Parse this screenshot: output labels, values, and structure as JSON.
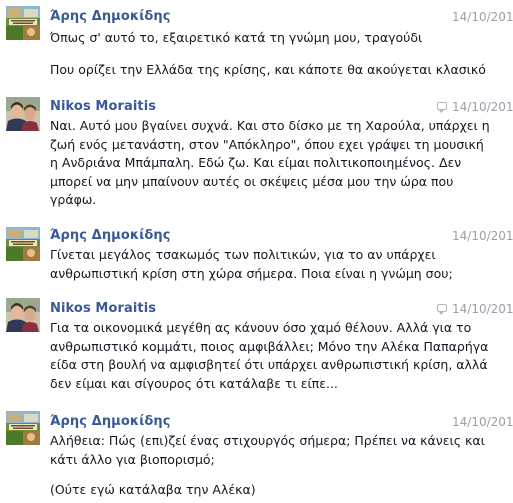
{
  "messages": [
    {
      "author": "Άρης Δημοκίδης",
      "time": "14/10/201",
      "seen_icon": false,
      "avatar": "collage-avatar",
      "paragraphs": [
        "Όπως σ' αυτό το, εξαιρετικό κατά τη γνώμη μου, τραγούδι",
        "Που ορίζει την Ελλάδα της κρίσης, και κάποτε θα ακούγεται κλασικό"
      ]
    },
    {
      "author": "Nikos Moraitis",
      "time": "14/10/201",
      "seen_icon": true,
      "avatar": "portrait-avatar",
      "paragraphs": [
        "Ναι. Αυτό μου βγαίνει συχνά. Και στο δίσκο με τη Χαρούλα, υπάρχει η ζωή ενός μετανάστη, στον \"Απόκληρο\", όπου εχει γράψει τη μουσική η Ανδριάνα Μπάμπαλη. Εδώ ζω. Και είμαι πολιτικοποιημένος. Δεν μπορεί να μην μπαίνουν αυτές οι σκέψεις μέσα μου την ώρα που γράφω."
      ]
    },
    {
      "author": "Άρης Δημοκίδης",
      "time": "14/10/201",
      "seen_icon": false,
      "avatar": "collage-avatar",
      "paragraphs": [
        "Γίνεται μεγάλος τσακωμός των πολιτικών, για το αν υπάρχει ανθρωπιστική κρίση στη χώρα σήμερα. Ποια είναι η γνώμη σου;"
      ]
    },
    {
      "author": "Nikos Moraitis",
      "time": "14/10/201",
      "seen_icon": true,
      "avatar": "portrait-avatar",
      "paragraphs": [
        "Για τα οικονομικά μεγέθη ας κάνουν όσο χαμό θέλουν. Αλλά για το ανθρωπιστικό κομμάτι, ποιος αμφιβάλλει; Μόνο την Αλέκα Παπαρήγα είδα στη βουλή να αμφισβητεί ότι υπάρχει ανθρωπιστική κρίση, αλλά δεν είμαι και σίγουρος ότι κατάλαβε τι είπε..."
      ]
    },
    {
      "author": "Άρης Δημοκίδης",
      "time": "14/10/201",
      "seen_icon": false,
      "avatar": "collage-avatar",
      "paragraphs": [
        "Αλήθεια: Πώς (επι)ζεί ένας στιχουργός σήμερα; Πρέπει να κάνεις και κάτι άλλο για βιοπορισμό;",
        "(Ούτε εγώ κατάλαβα την Αλέκα)"
      ]
    }
  ]
}
